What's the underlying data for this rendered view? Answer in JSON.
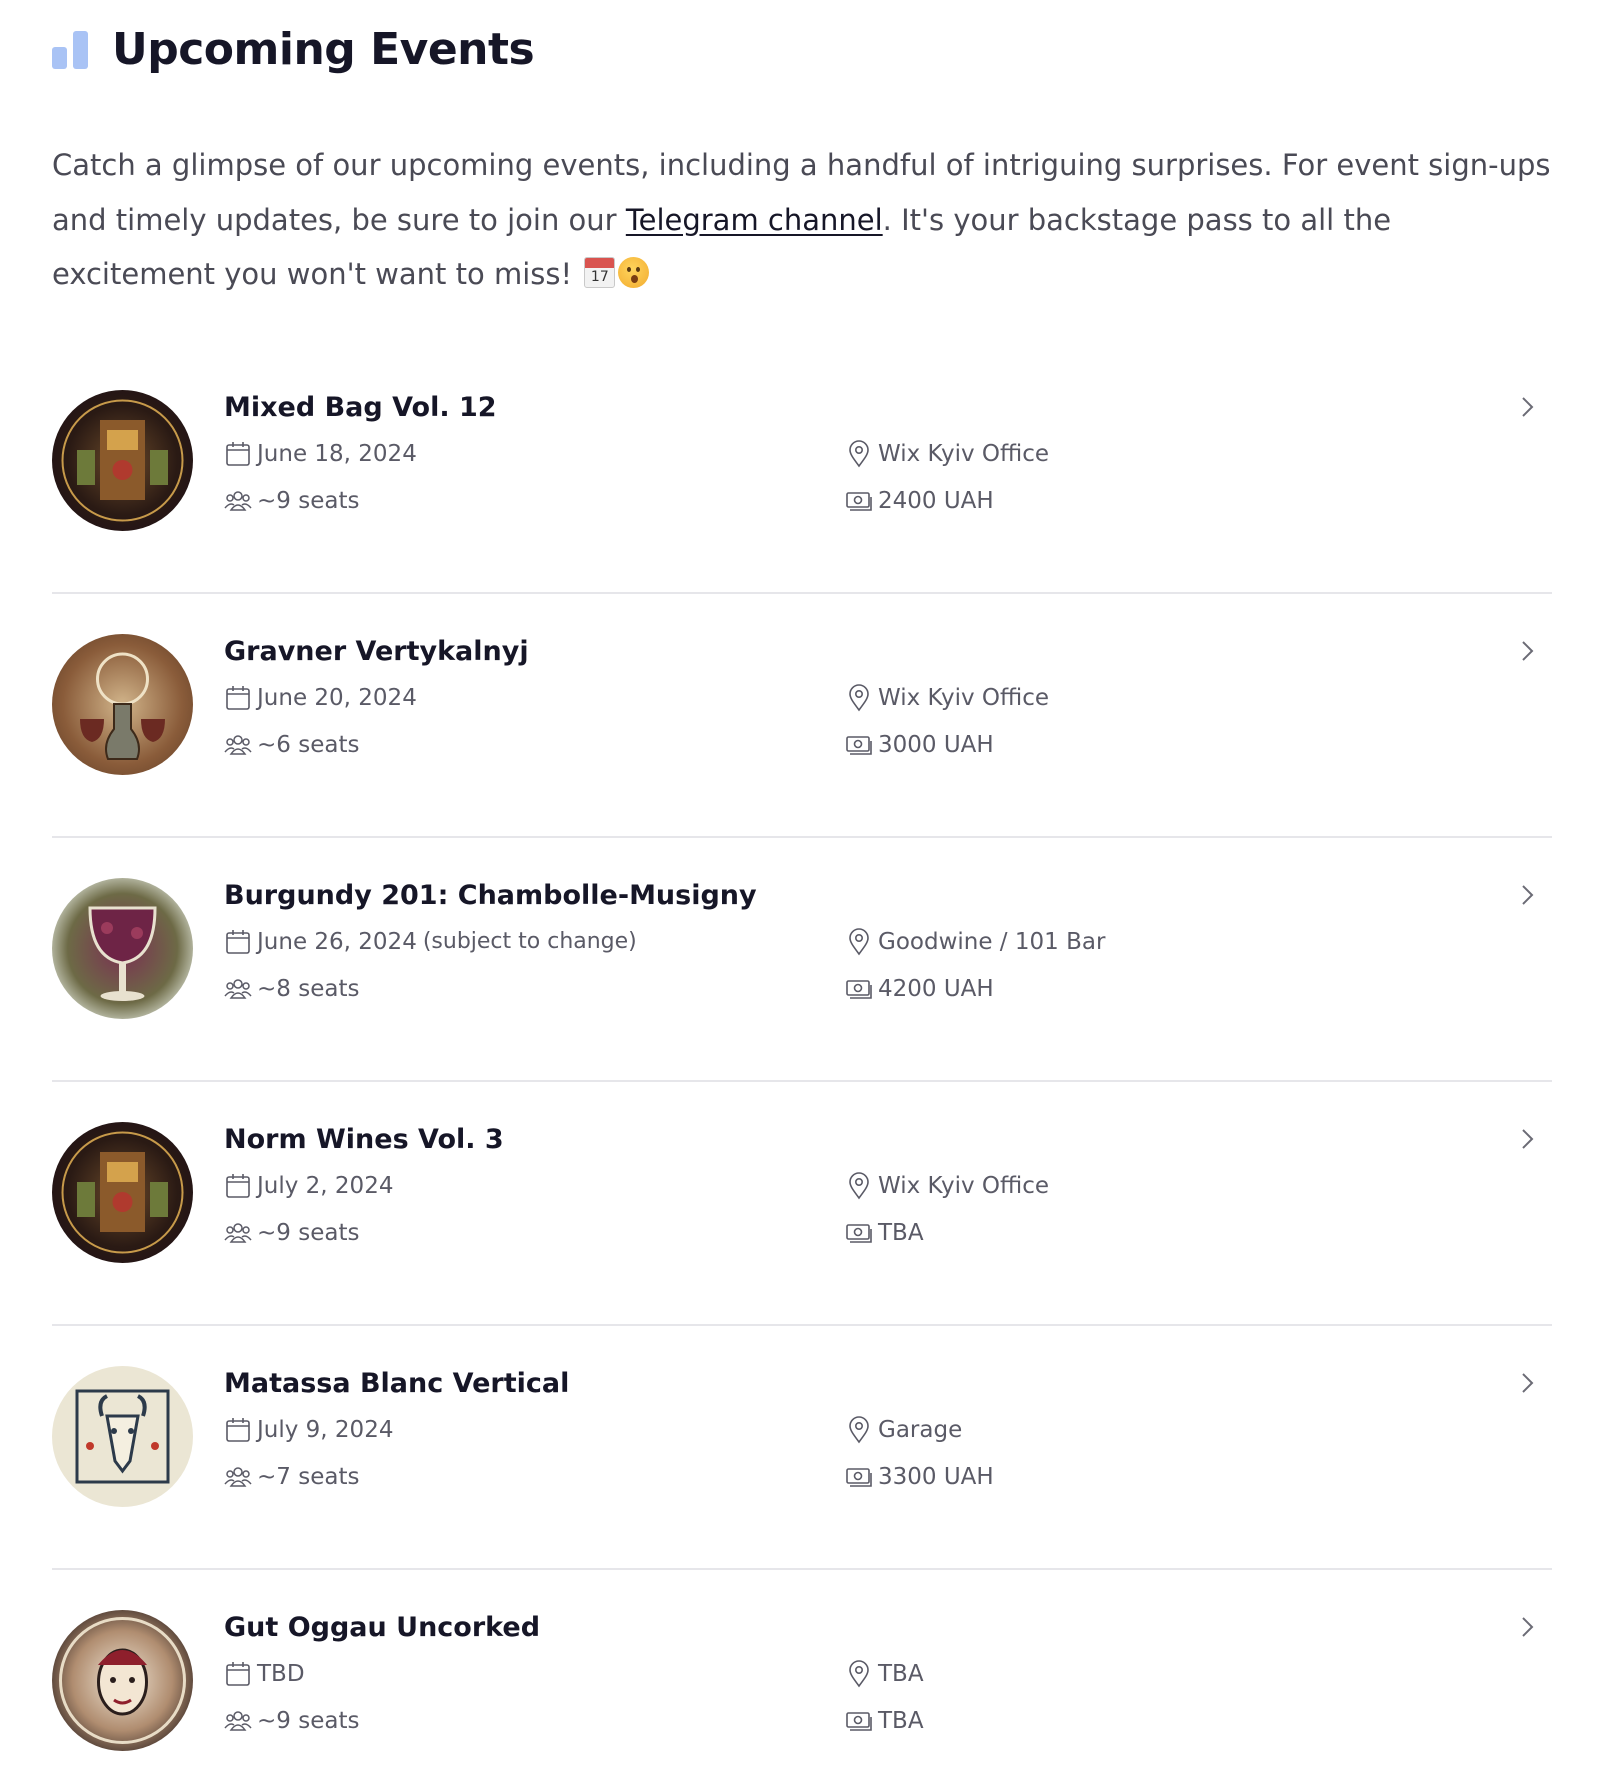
{
  "header": {
    "title": "Upcoming Events",
    "logo_icon": "bar-chart-icon",
    "accent_color": "#a9c3f5"
  },
  "intro": {
    "text_before": "Catch a glimpse of our upcoming events, including a handful of intriguing surprises. For event sign-ups and timely updates, be sure to join our ",
    "link_label": "Telegram channel",
    "text_after": ". It's your backstage pass to all the excitement you won't want to miss!",
    "emoji_calendar_day": "17"
  },
  "icons": {
    "date": "calendar-icon",
    "seats": "people-icon",
    "location": "map-pin-icon",
    "price": "cash-icon",
    "open": "chevron-right-icon"
  },
  "events": [
    {
      "title": "Mixed Bag Vol. 12",
      "date": "June 18, 2024",
      "date_note": "",
      "seats": "~9 seats",
      "location": "Wix Kyiv Office",
      "price": "2400 UAH",
      "image": "wine-mosaic-dark"
    },
    {
      "title": "Gravner Vertykalnyj",
      "date": "June 20, 2024",
      "date_note": "",
      "seats": "~6 seats",
      "location": "Wix Kyiv Office",
      "price": "3000 UAH",
      "image": "amphora-bronze"
    },
    {
      "title": "Burgundy 201: Chambolle-Musigny",
      "date": "June 26, 2024",
      "date_note": "(subject to change)",
      "seats": "~8 seats",
      "location": "Goodwine / 101 Bar",
      "price": "4200 UAH",
      "image": "wine-glass-vineyard"
    },
    {
      "title": "Norm Wines Vol. 3",
      "date": "July 2, 2024",
      "date_note": "",
      "seats": "~9 seats",
      "location": "Wix Kyiv Office",
      "price": "TBA",
      "image": "wine-mosaic-dark"
    },
    {
      "title": "Matassa Blanc Vertical",
      "date": "July 9, 2024",
      "date_note": "",
      "seats": "~7 seats",
      "location": "Garage",
      "price": "3300 UAH",
      "image": "goat-crest"
    },
    {
      "title": "Gut Oggau Uncorked",
      "date": "TBD",
      "date_note": "",
      "seats": "~9 seats",
      "location": "TBA",
      "price": "TBA",
      "image": "faces-mosaic"
    }
  ]
}
